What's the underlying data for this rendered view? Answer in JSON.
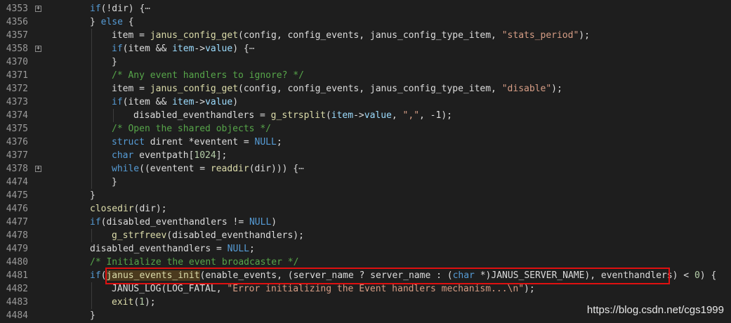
{
  "editor": {
    "lines": [
      {
        "num": "4353",
        "fold": true,
        "indent": 0,
        "tokens": [
          [
            "kw",
            "if"
          ],
          [
            "op",
            "(!dir) {"
          ],
          [
            "ell",
            "⋯"
          ]
        ]
      },
      {
        "num": "4356",
        "fold": false,
        "indent": 0,
        "tokens": [
          [
            "op",
            "} "
          ],
          [
            "kw",
            "else"
          ],
          [
            "op",
            " {"
          ]
        ]
      },
      {
        "num": "4357",
        "fold": false,
        "indent": 1,
        "tokens": [
          [
            "op",
            "item = "
          ],
          [
            "fn",
            "janus_config_get"
          ],
          [
            "op",
            "(config, config_events, janus_config_type_item, "
          ],
          [
            "st",
            "\"stats_period\""
          ],
          [
            "op",
            ");"
          ]
        ]
      },
      {
        "num": "4358",
        "fold": true,
        "indent": 1,
        "tokens": [
          [
            "kw",
            "if"
          ],
          [
            "op",
            "(item && "
          ],
          [
            "mc",
            "item"
          ],
          [
            "op",
            "->"
          ],
          [
            "mc",
            "value"
          ],
          [
            "op",
            ") {"
          ],
          [
            "ell",
            "⋯"
          ]
        ]
      },
      {
        "num": "4370",
        "fold": false,
        "indent": 1,
        "tokens": [
          [
            "op",
            "}"
          ]
        ]
      },
      {
        "num": "4371",
        "fold": false,
        "indent": 1,
        "tokens": [
          [
            "cm",
            "/* Any event handlers to ignore? */"
          ]
        ]
      },
      {
        "num": "4372",
        "fold": false,
        "indent": 1,
        "tokens": [
          [
            "op",
            "item = "
          ],
          [
            "fn",
            "janus_config_get"
          ],
          [
            "op",
            "(config, config_events, janus_config_type_item, "
          ],
          [
            "st",
            "\"disable\""
          ],
          [
            "op",
            ");"
          ]
        ]
      },
      {
        "num": "4373",
        "fold": false,
        "indent": 1,
        "tokens": [
          [
            "kw",
            "if"
          ],
          [
            "op",
            "(item && "
          ],
          [
            "mc",
            "item"
          ],
          [
            "op",
            "->"
          ],
          [
            "mc",
            "value"
          ],
          [
            "op",
            ")"
          ]
        ]
      },
      {
        "num": "4374",
        "fold": false,
        "indent": 2,
        "tokens": [
          [
            "op",
            "disabled_eventhandlers = "
          ],
          [
            "fn",
            "g_strsplit"
          ],
          [
            "op",
            "("
          ],
          [
            "mc",
            "item"
          ],
          [
            "op",
            "->"
          ],
          [
            "mc",
            "value"
          ],
          [
            "op",
            ", "
          ],
          [
            "st",
            "\",\""
          ],
          [
            "op",
            ", -1);"
          ]
        ]
      },
      {
        "num": "4375",
        "fold": false,
        "indent": 1,
        "tokens": [
          [
            "cm",
            "/* Open the shared objects */"
          ]
        ]
      },
      {
        "num": "4376",
        "fold": false,
        "indent": 1,
        "tokens": [
          [
            "kw",
            "struct"
          ],
          [
            "op",
            " dirent *eventent = "
          ],
          [
            "kw",
            "NULL"
          ],
          [
            "op",
            ";"
          ]
        ]
      },
      {
        "num": "4377",
        "fold": false,
        "indent": 1,
        "tokens": [
          [
            "kw",
            "char"
          ],
          [
            "op",
            " eventpath["
          ],
          [
            "nm",
            "1024"
          ],
          [
            "op",
            "];"
          ]
        ]
      },
      {
        "num": "4378",
        "fold": true,
        "indent": 1,
        "tokens": [
          [
            "kw",
            "while"
          ],
          [
            "op",
            "((eventent = "
          ],
          [
            "fn",
            "readdir"
          ],
          [
            "op",
            "(dir))) {"
          ],
          [
            "ell",
            "⋯"
          ]
        ]
      },
      {
        "num": "4474",
        "fold": false,
        "indent": 1,
        "tokens": [
          [
            "op",
            "}"
          ]
        ]
      },
      {
        "num": "4475",
        "fold": false,
        "indent": 0,
        "tokens": [
          [
            "op",
            "}"
          ]
        ]
      },
      {
        "num": "4476",
        "fold": false,
        "indent": 0,
        "tokens": [
          [
            "fn",
            "closedir"
          ],
          [
            "op",
            "(dir);"
          ]
        ]
      },
      {
        "num": "4477",
        "fold": false,
        "indent": 0,
        "tokens": [
          [
            "kw",
            "if"
          ],
          [
            "op",
            "(disabled_eventhandlers != "
          ],
          [
            "kw",
            "NULL"
          ],
          [
            "op",
            ")"
          ]
        ]
      },
      {
        "num": "4478",
        "fold": false,
        "indent": 1,
        "tokens": [
          [
            "fn",
            "g_strfreev"
          ],
          [
            "op",
            "(disabled_eventhandlers);"
          ]
        ]
      },
      {
        "num": "4479",
        "fold": false,
        "indent": 0,
        "tokens": [
          [
            "op",
            "disabled_eventhandlers = "
          ],
          [
            "kw",
            "NULL"
          ],
          [
            "op",
            ";"
          ]
        ]
      },
      {
        "num": "4480",
        "fold": false,
        "indent": 0,
        "tokens": [
          [
            "cm",
            "/* Initialize the event broadcaster */"
          ]
        ]
      },
      {
        "num": "4481",
        "fold": false,
        "indent": 0,
        "tokens": [
          [
            "kw",
            "if"
          ],
          [
            "op",
            "("
          ],
          [
            "fnh",
            "janus_events_init"
          ],
          [
            "op",
            "(enable_events, (server_name ? server_name : ("
          ],
          [
            "kw",
            "char"
          ],
          [
            "op",
            " *)JANUS_SERVER_NAME), eventhandlers) < "
          ],
          [
            "nm",
            "0"
          ],
          [
            "op",
            ") {"
          ]
        ]
      },
      {
        "num": "4482",
        "fold": false,
        "indent": 1,
        "tokens": [
          [
            "op",
            "JANUS_LOG(LOG_FATAL, "
          ],
          [
            "st",
            "\"Error initializing the Event handlers mechanism...\\n\""
          ],
          [
            "op",
            ");"
          ]
        ]
      },
      {
        "num": "4483",
        "fold": false,
        "indent": 1,
        "tokens": [
          [
            "fn",
            "exit"
          ],
          [
            "op",
            "("
          ],
          [
            "nm",
            "1"
          ],
          [
            "op",
            ");"
          ]
        ]
      },
      {
        "num": "4484",
        "fold": false,
        "indent": 0,
        "tokens": [
          [
            "op",
            "}"
          ]
        ]
      }
    ]
  },
  "fold_glyph": "+",
  "watermark": "https://blog.csdn.net/cgs1999",
  "colors": {
    "background": "#1e1e1e",
    "keyword": "#569cd6",
    "function": "#dcdcaa",
    "member": "#9cdcfe",
    "string": "#d69d85",
    "comment": "#57a64a",
    "number": "#b5cea8",
    "highlight_box": "#e01010"
  }
}
